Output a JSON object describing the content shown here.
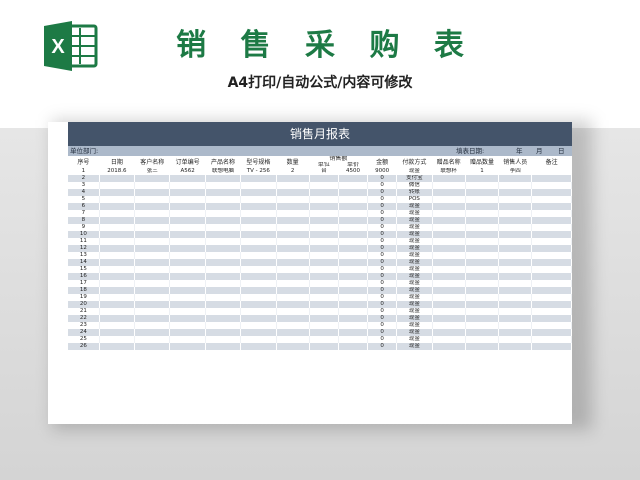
{
  "header": {
    "title": "销 售 采 购 表",
    "subtitle": "A4打印/自动公式/内容可修改",
    "logo_letter": "X",
    "accent_color": "#1d7a45"
  },
  "sheet": {
    "report_title": "销售月报表",
    "info": {
      "dept_label": "单位部门:",
      "fill_date_label": "填表日期:",
      "year": "年",
      "month": "月",
      "day": "日"
    },
    "columns": [
      "序号",
      "日期",
      "客户名称",
      "订单编号",
      "产品名称",
      "型号规格",
      "数量",
      "单位",
      "单价",
      "金额",
      "付款方式",
      "赠品名称",
      "赠品数量",
      "销售人员",
      "备注"
    ],
    "group_header": "销售额",
    "first_row": [
      "1",
      "2018.6",
      "张三",
      "A562",
      "联想电脑",
      "TV - 256",
      "2",
      "台",
      "4500",
      "9000",
      "现金",
      "联想杯",
      "1",
      "李四",
      ""
    ],
    "rows": [
      {
        "no": "2",
        "amount": "0",
        "pay": "支付宝"
      },
      {
        "no": "3",
        "amount": "0",
        "pay": "微信"
      },
      {
        "no": "4",
        "amount": "0",
        "pay": "转账"
      },
      {
        "no": "5",
        "amount": "0",
        "pay": "POS"
      },
      {
        "no": "6",
        "amount": "0",
        "pay": "现金"
      },
      {
        "no": "7",
        "amount": "0",
        "pay": "现金"
      },
      {
        "no": "8",
        "amount": "0",
        "pay": "现金"
      },
      {
        "no": "9",
        "amount": "0",
        "pay": "现金"
      },
      {
        "no": "10",
        "amount": "0",
        "pay": "现金"
      },
      {
        "no": "11",
        "amount": "0",
        "pay": "现金"
      },
      {
        "no": "12",
        "amount": "0",
        "pay": "现金"
      },
      {
        "no": "13",
        "amount": "0",
        "pay": "现金"
      },
      {
        "no": "14",
        "amount": "0",
        "pay": "现金"
      },
      {
        "no": "15",
        "amount": "0",
        "pay": "现金"
      },
      {
        "no": "16",
        "amount": "0",
        "pay": "现金"
      },
      {
        "no": "17",
        "amount": "0",
        "pay": "现金"
      },
      {
        "no": "18",
        "amount": "0",
        "pay": "现金"
      },
      {
        "no": "19",
        "amount": "0",
        "pay": "现金"
      },
      {
        "no": "20",
        "amount": "0",
        "pay": "现金"
      },
      {
        "no": "21",
        "amount": "0",
        "pay": "现金"
      },
      {
        "no": "22",
        "amount": "0",
        "pay": "现金"
      },
      {
        "no": "23",
        "amount": "0",
        "pay": "现金"
      },
      {
        "no": "24",
        "amount": "0",
        "pay": "现金"
      },
      {
        "no": "25",
        "amount": "0",
        "pay": "现金"
      },
      {
        "no": "26",
        "amount": "0",
        "pay": "现金"
      }
    ]
  }
}
